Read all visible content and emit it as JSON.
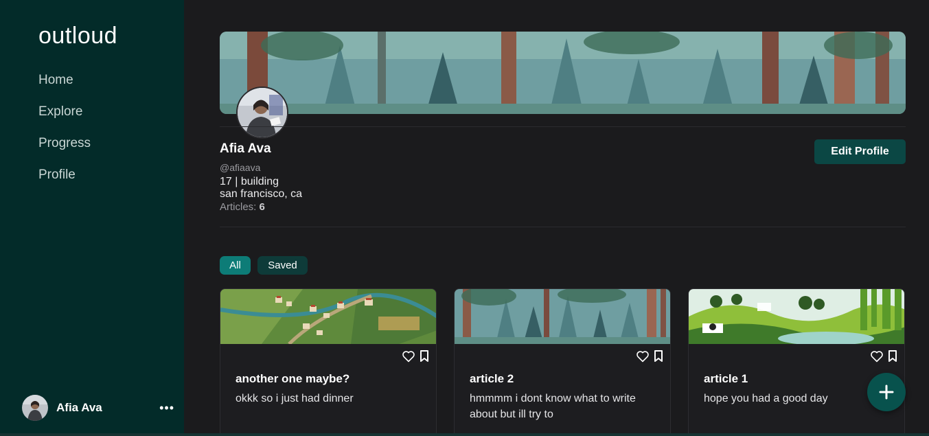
{
  "app": {
    "logo": "outloud"
  },
  "sidebar": {
    "items": [
      {
        "label": "Home"
      },
      {
        "label": "Explore"
      },
      {
        "label": "Progress"
      },
      {
        "label": "Profile"
      }
    ],
    "user": {
      "name": "Afia Ava",
      "more_icon": "more-dots-icon"
    }
  },
  "profile": {
    "name": "Afia Ava",
    "handle": "@afiaava",
    "bio_line1": "17 | building",
    "bio_line2": "san francisco, ca",
    "articles_label": "Articles:",
    "articles_count": "6",
    "edit_label": "Edit Profile"
  },
  "tabs": [
    {
      "label": "All",
      "active": true
    },
    {
      "label": "Saved",
      "active": false
    }
  ],
  "articles": [
    {
      "title": "another one maybe?",
      "snippet": "okkk so i just had dinner",
      "image": "village-landscape"
    },
    {
      "title": "article 2",
      "snippet": "hmmmm i dont know what to write about but ill try to",
      "image": "forest"
    },
    {
      "title": "article 1",
      "snippet": "hope you had a good day",
      "image": "green-hills"
    }
  ],
  "icons": {
    "like": "heart-icon",
    "save": "bookmark-icon",
    "add": "plus-icon"
  },
  "colors": {
    "sidebar_bg": "#032b29",
    "page_bg": "#1b1b1d",
    "accent": "#0d7c77",
    "button_bg": "#0b4744",
    "fab_bg": "#08524d"
  }
}
